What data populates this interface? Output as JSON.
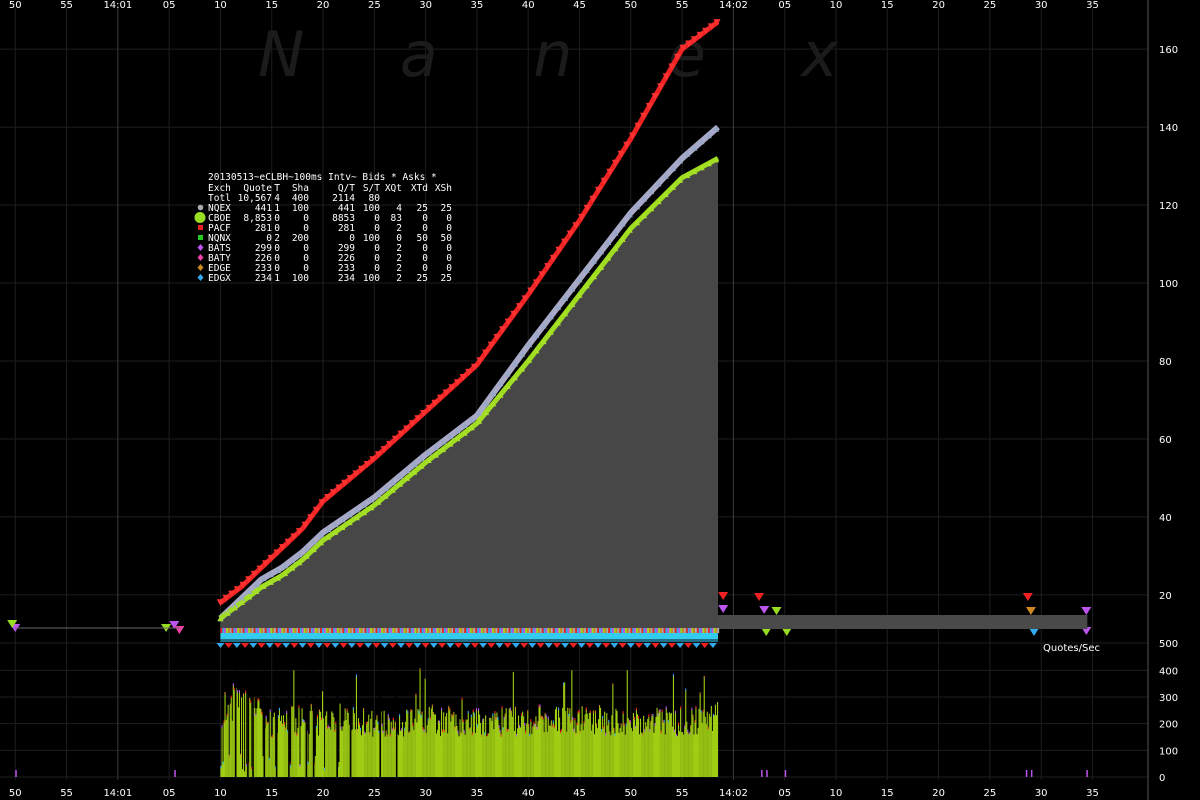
{
  "watermark": "Nanex",
  "colors": {
    "background": "#000000",
    "grid": "#1e1e1e",
    "nbbo_fill": "#474747",
    "bid_line": "#9fdd20",
    "ask_line": "#ee2222",
    "bid_volume": "#9fcd14"
  },
  "table": {
    "title": "20130513~eCLBH~100ms Intv~ Bids * Asks *",
    "columns": [
      "Exch",
      "Quote",
      "T",
      "Sha",
      "Q/T",
      "S/T",
      "XQt",
      "XTd",
      "XSh"
    ],
    "total": [
      "Totl",
      "10,567",
      "4",
      "400",
      "2114",
      "80",
      "",
      "",
      ""
    ],
    "rows": [
      {
        "exch": "NQEX",
        "color": "#aaaaaa",
        "marker": "dot",
        "quote": "441",
        "t": "1",
        "sha": "100",
        "qt": "441",
        "st": "100",
        "xqt": "4",
        "xtd": "25",
        "xsh": "25"
      },
      {
        "exch": "CBOE",
        "color": "#99dd22",
        "marker": "big-dot",
        "quote": "8,853",
        "t": "0",
        "sha": "0",
        "qt": "8853",
        "st": "0",
        "xqt": "83",
        "xtd": "0",
        "xsh": "0"
      },
      {
        "exch": "PACF",
        "color": "#ee2222",
        "marker": "square",
        "quote": "281",
        "t": "0",
        "sha": "0",
        "qt": "281",
        "st": "0",
        "xqt": "2",
        "xtd": "0",
        "xsh": "0"
      },
      {
        "exch": "NQNX",
        "color": "#22cc22",
        "marker": "square",
        "quote": "0",
        "t": "2",
        "sha": "200",
        "qt": "0",
        "st": "100",
        "xqt": "0",
        "xtd": "50",
        "xsh": "50"
      },
      {
        "exch": "BATS",
        "color": "#bb55ee",
        "marker": "diamond",
        "quote": "299",
        "t": "0",
        "sha": "0",
        "qt": "299",
        "st": "0",
        "xqt": "2",
        "xtd": "0",
        "xsh": "0"
      },
      {
        "exch": "BATY",
        "color": "#ee44aa",
        "marker": "diamond",
        "quote": "226",
        "t": "0",
        "sha": "0",
        "qt": "226",
        "st": "0",
        "xqt": "2",
        "xtd": "0",
        "xsh": "0"
      },
      {
        "exch": "EDGE",
        "color": "#cc8822",
        "marker": "diamond",
        "quote": "233",
        "t": "0",
        "sha": "0",
        "qt": "233",
        "st": "0",
        "xqt": "2",
        "xtd": "0",
        "xsh": "0"
      },
      {
        "exch": "EDGX",
        "color": "#33aaee",
        "marker": "diamond",
        "quote": "234",
        "t": "1",
        "sha": "100",
        "qt": "234",
        "st": "100",
        "xqt": "2",
        "xtd": "25",
        "xsh": "25"
      }
    ]
  },
  "quotes_sec_label": "Quotes/Sec",
  "chart_data": {
    "type": "line",
    "x_ticks": [
      "50",
      "55",
      "14:01",
      "05",
      "10",
      "15",
      "20",
      "25",
      "30",
      "35",
      "40",
      "45",
      "50",
      "55",
      "14:02",
      "05",
      "10",
      "15",
      "20",
      "25",
      "30",
      "35"
    ],
    "x_tick_times": [
      -10,
      -5,
      0,
      5,
      10,
      15,
      20,
      25,
      30,
      35,
      40,
      45,
      50,
      55,
      60,
      65,
      70,
      75,
      80,
      85,
      90,
      95
    ],
    "xlim": [
      -11,
      97
    ],
    "price_panel": {
      "y_ticks": [
        20,
        40,
        60,
        80,
        100,
        120,
        140,
        160
      ],
      "ylim": [
        11,
        169
      ],
      "series": [
        {
          "role": "ask",
          "color": "#ee2222",
          "x": [
            10,
            12,
            14,
            16,
            18,
            20,
            25,
            30,
            35,
            40,
            45,
            50,
            55,
            58.5
          ],
          "y": [
            18,
            22,
            27,
            32,
            37,
            44,
            55,
            67,
            79,
            97,
            116,
            137,
            160,
            167
          ]
        },
        {
          "role": "quotes",
          "color": "#a9a9c8",
          "x": [
            10,
            12,
            14,
            16,
            18,
            20,
            25,
            30,
            35,
            40,
            45,
            50,
            55,
            58.5
          ],
          "y": [
            14,
            19,
            24,
            27,
            31,
            36,
            45,
            56,
            66,
            84,
            101,
            118,
            132,
            140
          ]
        },
        {
          "role": "bid",
          "color": "#9fdd20",
          "x": [
            10,
            12,
            14,
            16,
            18,
            20,
            25,
            30,
            35,
            40,
            45,
            50,
            55,
            58.5
          ],
          "y": [
            14,
            18,
            22,
            25,
            29,
            34,
            43,
            54,
            64,
            80,
            97,
            114,
            127,
            132
          ]
        }
      ]
    },
    "spread_panel": {
      "y_ticks": [
        500
      ],
      "ylim": [
        0,
        550
      ],
      "spread_end_time": 94.5
    },
    "volume_panel": {
      "y_ticks": [
        0,
        100,
        200,
        300,
        400
      ],
      "ylim": [
        0,
        420
      ],
      "profile": {
        "x": [
          10,
          11,
          12,
          13,
          14,
          15,
          17,
          19,
          20,
          22,
          25,
          30,
          35,
          40,
          45,
          50,
          55,
          58.5
        ],
        "y": [
          250,
          290,
          300,
          260,
          230,
          210,
          220,
          230,
          210,
          240,
          210,
          220,
          215,
          220,
          225,
          215,
          220,
          240
        ]
      }
    }
  }
}
